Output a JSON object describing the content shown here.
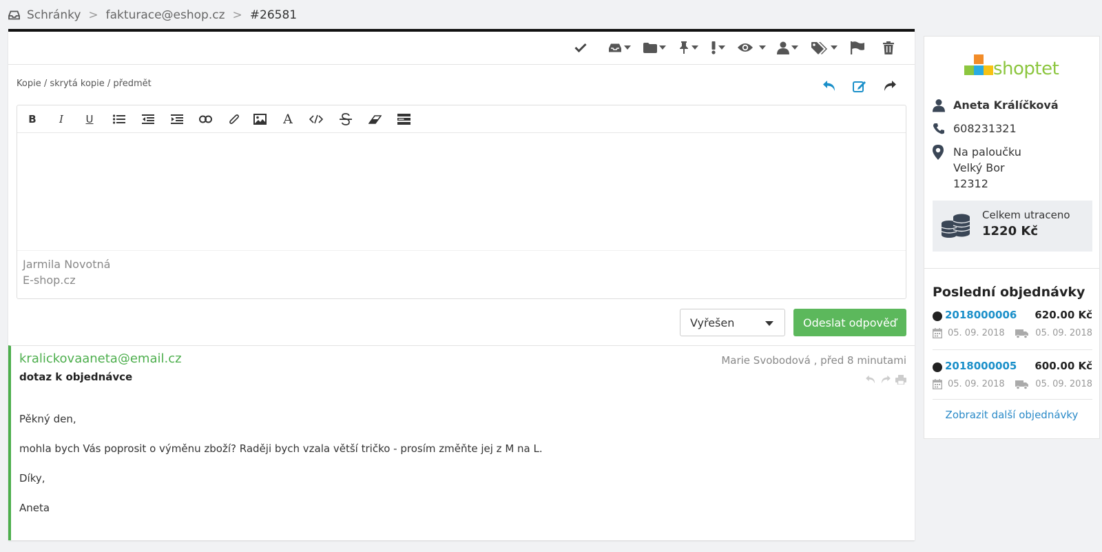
{
  "breadcrumb": {
    "root": "Schránky",
    "mailbox": "fakturace@eshop.cz",
    "ticket": "#26581",
    "separator": ">"
  },
  "toolbar": {
    "icons": [
      "check-icon",
      "inbox-icon",
      "folder-icon",
      "pin-icon",
      "exclamation-icon",
      "eye-icon",
      "user-icon",
      "tags-icon",
      "flag-icon",
      "trash-icon"
    ]
  },
  "reply": {
    "cc_link": "Kopie / skrytá kopie / předmět",
    "signature_name": "Jarmila Novotná",
    "signature_company": "E-shop.cz",
    "status_value": "Vyřešen",
    "send_label": "Odeslat odpověď"
  },
  "editor": {
    "bold": "B",
    "italic": "I",
    "underline": "U",
    "font": "A"
  },
  "message": {
    "from": "kralickovaaneta@email.cz",
    "meta": "Marie Svobodová , před 8 minutami",
    "subject": "dotaz k objednávce",
    "body": [
      "Pěkný den,",
      "mohla bych Vás poprosit o výměnu zboží? Raději bych vzala větší tričko - prosím změňte jej z M na L.",
      "Díky,",
      "Aneta"
    ]
  },
  "customer": {
    "logo_text": "shoptet",
    "name": "Aneta Králíčková",
    "phone": "608231321",
    "address": [
      "Na paloučku",
      "Velký Bor",
      "12312"
    ],
    "spent_label": "Celkem utraceno",
    "spent_value": "1220 Kč"
  },
  "orders": {
    "title": "Poslední objednávky",
    "items": [
      {
        "number": "2018000006",
        "price": "620.00 Kč",
        "created": "05. 09. 2018",
        "shipped": "05. 09. 2018"
      },
      {
        "number": "2018000005",
        "price": "600.00 Kč",
        "created": "05. 09. 2018",
        "shipped": "05. 09. 2018"
      }
    ],
    "more": "Zobrazit další objednávky"
  },
  "colors": {
    "accent_green": "#5cb85c",
    "link_blue": "#1a8fc9",
    "message_border": "#4cae4c"
  }
}
